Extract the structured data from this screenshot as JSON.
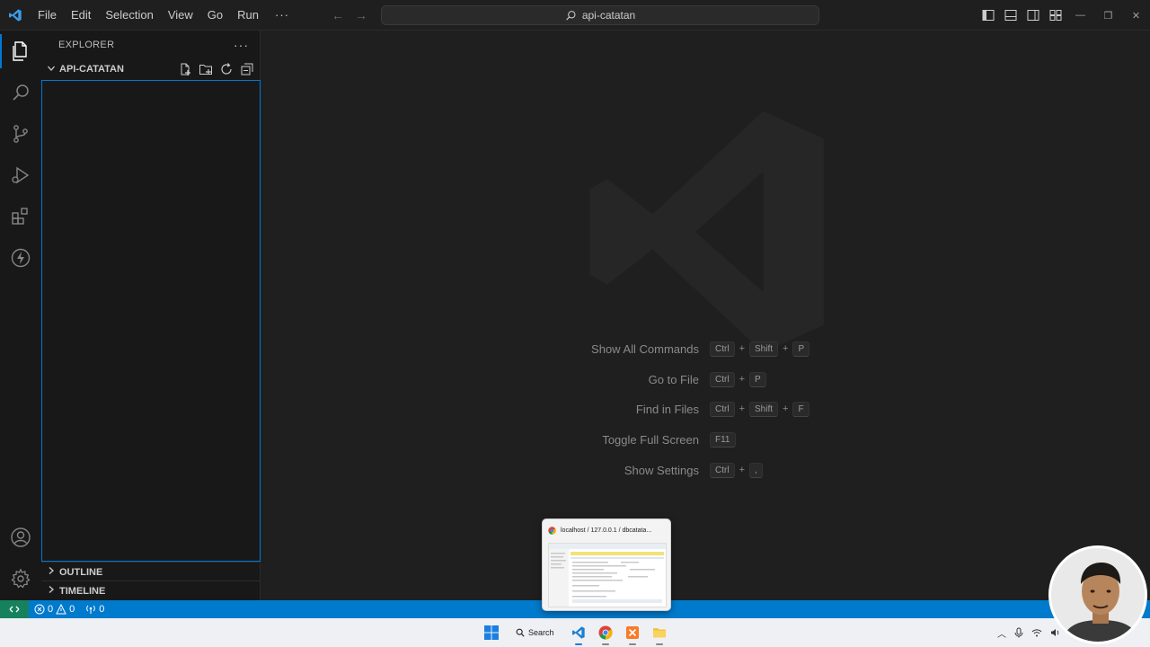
{
  "menu": {
    "items": [
      "File",
      "Edit",
      "Selection",
      "View",
      "Go",
      "Run"
    ],
    "more": "···"
  },
  "command_center": {
    "label": "api-catatan"
  },
  "sidebar": {
    "title": "EXPLORER",
    "more": "···",
    "folder": "API-CATATAN",
    "sections": [
      "OUTLINE",
      "TIMELINE"
    ]
  },
  "shortcuts": [
    {
      "label": "Show All Commands",
      "keys": [
        "Ctrl",
        "Shift",
        "P"
      ]
    },
    {
      "label": "Go to File",
      "keys": [
        "Ctrl",
        "P"
      ]
    },
    {
      "label": "Find in Files",
      "keys": [
        "Ctrl",
        "Shift",
        "F"
      ]
    },
    {
      "label": "Toggle Full Screen",
      "keys": [
        "F11"
      ]
    },
    {
      "label": "Show Settings",
      "keys": [
        "Ctrl",
        ","
      ]
    }
  ],
  "status": {
    "errors": "0",
    "warnings": "0",
    "ports": "0"
  },
  "taskbar": {
    "search_label": "Search"
  },
  "preview": {
    "title": "localhost / 127.0.0.1 / dbcatata..."
  },
  "colors": {
    "accent": "#0078d4",
    "statusbar": "#007acc",
    "remote": "#16825d"
  }
}
